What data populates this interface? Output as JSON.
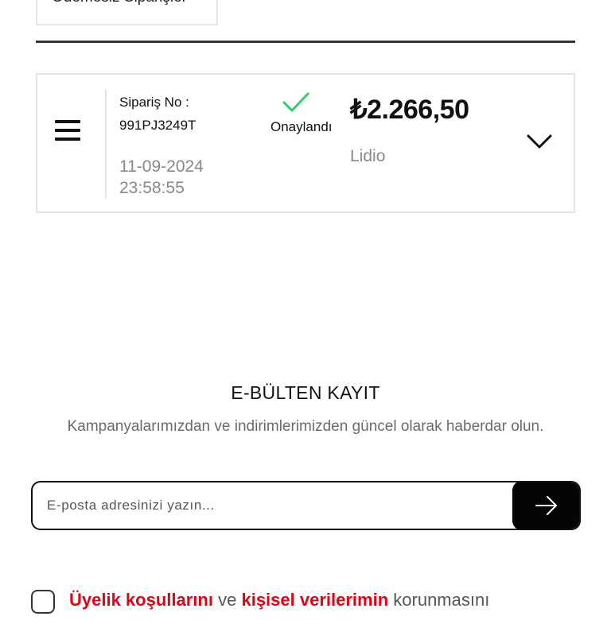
{
  "top_tab": {
    "label": "Ödemesiz Siparişler"
  },
  "order": {
    "order_no_label": "Sipariş No :",
    "order_no": "991PJ3249T",
    "date": "11-09-2024",
    "time": "23:58:55",
    "status": "Onaylandı",
    "status_color": "#2ecc71",
    "price": "₺2.266,50",
    "brand": "Lidio"
  },
  "newsletter": {
    "title": "E-BÜLTEN KAYIT",
    "description": "Kampanyalarımızdan ve indirimlerimizden güncel olarak haberdar olun.",
    "email_placeholder": "E-posta adresinizi yazın..."
  },
  "consent": {
    "link1": "Üyelik koşullarını",
    "conj": "ve",
    "link2": "kişisel verilerimin",
    "rest": "korunmasını",
    "link_color": "#e60012"
  }
}
